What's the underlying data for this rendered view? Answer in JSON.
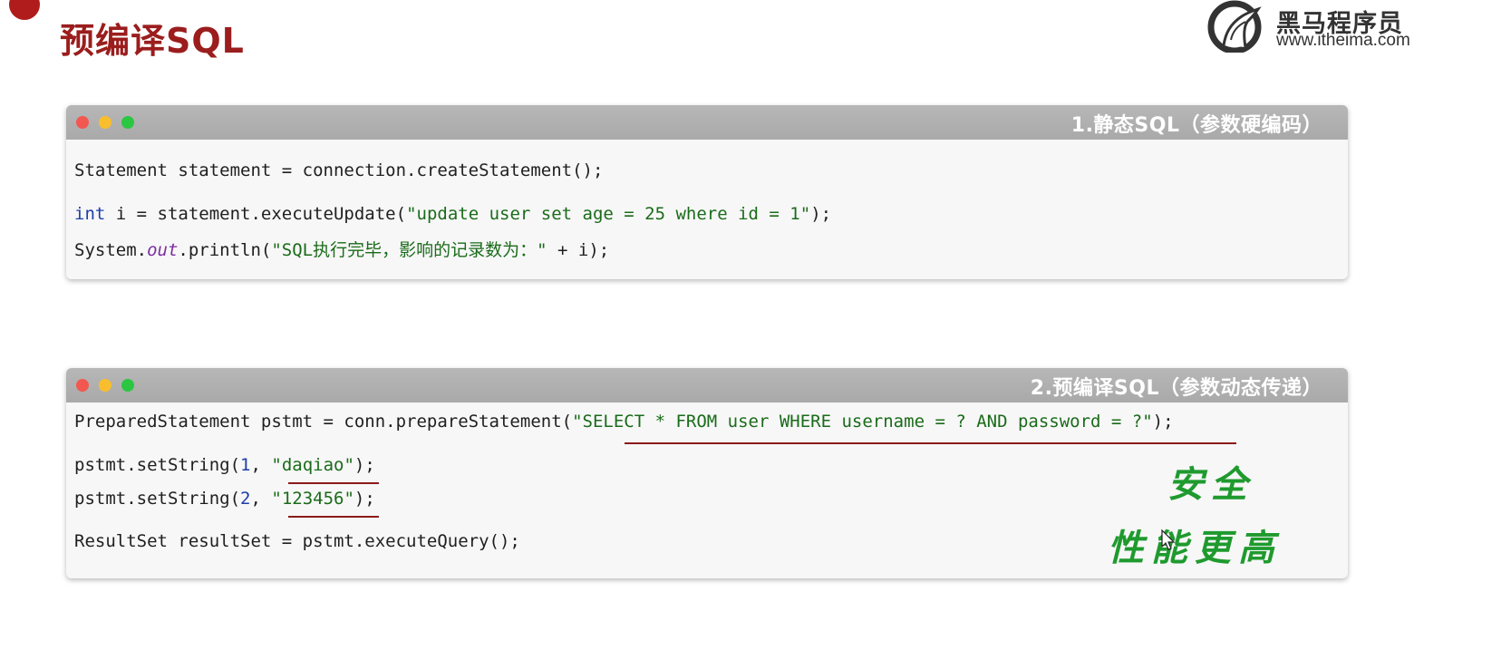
{
  "page": {
    "title": "预编译SQL"
  },
  "logo": {
    "name_cn": "黑马程序员",
    "url": "www.itheima.com"
  },
  "colors": {
    "title": "#9b1d1d",
    "string": "#1a6b1a",
    "keyword": "#1d3fa8",
    "field": "#7a2e9e",
    "note": "#1f9a2e"
  },
  "card1": {
    "caption": "1.静态SQL（参数硬编码）",
    "line1": "Statement statement = connection.createStatement();",
    "line2": {
      "kw": "int",
      "pre": " i = statement.executeUpdate(",
      "str": "\"update user set age = 25 where id = 1\"",
      "post": ");"
    },
    "line3": {
      "pre": "System.",
      "fld": "out",
      "mid": ".println(",
      "str": "\"SQL执行完毕，影响的记录数为：\"",
      "post": " + i);"
    }
  },
  "card2": {
    "caption": "2.预编译SQL（参数动态传递）",
    "line1": {
      "pre": "PreparedStatement pstmt = conn.prepareStatement(",
      "str": "\"SELECT * FROM user WHERE username = ? AND password = ?\"",
      "post": ");"
    },
    "line2": {
      "pre": "pstmt.setString(",
      "num": "1",
      "mid": ", ",
      "str": "\"daqiao\"",
      "post": ");"
    },
    "line3": {
      "pre": "pstmt.setString(",
      "num": "2",
      "mid": ", ",
      "str": "\"123456\"",
      "post": ");"
    },
    "line4": "ResultSet resultSet = pstmt.executeQuery();"
  },
  "notes": {
    "safe": "安全",
    "perf": "性能更高"
  }
}
